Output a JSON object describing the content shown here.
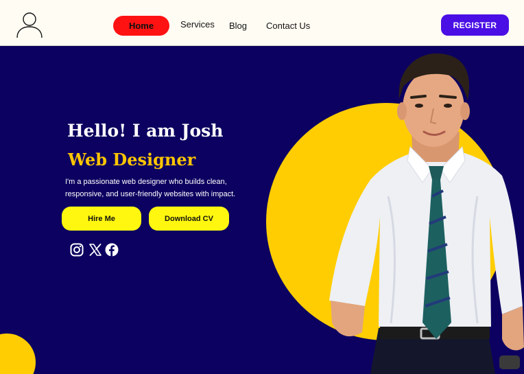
{
  "header": {
    "nav": {
      "home": "Home",
      "services": "Services",
      "blog": "Blog",
      "contact": "Contact Us"
    },
    "register_label": "REGISTER",
    "icons": [
      "user-avatar-icon"
    ]
  },
  "hero": {
    "greeting": "Hello! I am Josh",
    "role": "Web Designer",
    "description_line1": "I'm a passionate web designer who builds clean,",
    "description_line2": "responsive, and user-friendly websites with impact.",
    "hire_label": "Hire Me",
    "cv_label": "Download CV",
    "social_icons": [
      "instagram-icon",
      "x-icon",
      "facebook-icon"
    ]
  },
  "colors": {
    "background": "#0c0160",
    "header_bg": "#fffcf3",
    "home_pill": "#ff1212",
    "register_button": "#4a0fe4",
    "role_text": "#ffc602",
    "action_button": "#fff70f",
    "accent_circle": "#ffcd02"
  }
}
